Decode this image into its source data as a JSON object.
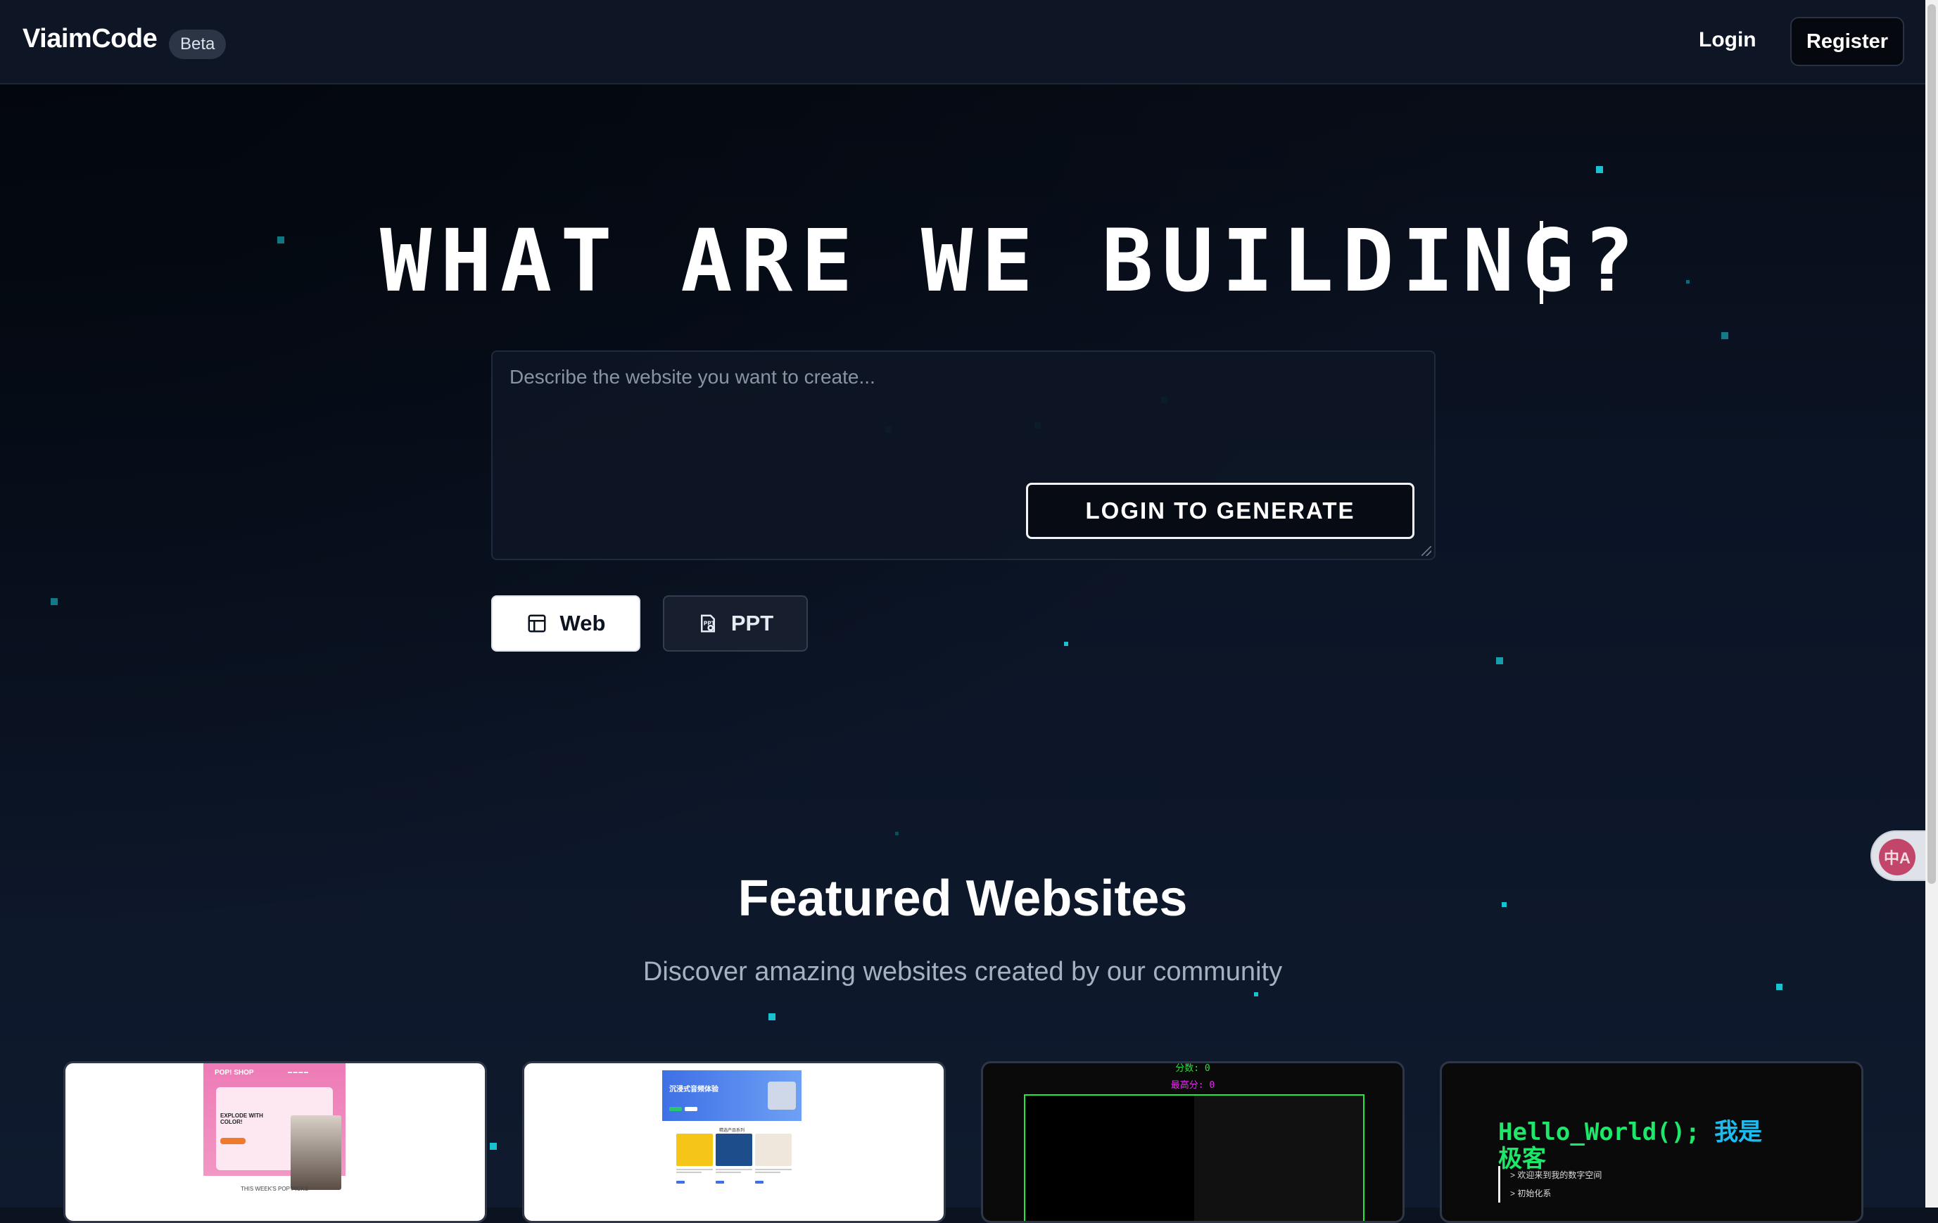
{
  "navbar": {
    "brand": "ViaimCode",
    "badge": "Beta",
    "login_label": "Login",
    "register_label": "Register"
  },
  "hero": {
    "title": "WHAT ARE WE BUILDING?",
    "prompt_placeholder": "Describe the website you want to create...",
    "generate_label": "LOGIN TO GENERATE",
    "modes": [
      {
        "label": "Web",
        "icon": "layout-icon",
        "selected": true
      },
      {
        "label": "PPT",
        "icon": "presentation-file-icon",
        "selected": false
      }
    ]
  },
  "featured": {
    "title": "Featured Websites",
    "subtitle": "Discover amazing websites created by our community",
    "cards": [
      {
        "shop_logo": "POP! SHOP",
        "hero_text": "EXPLODE WITH COLOR!",
        "caption": "THIS WEEK'S POP PICKS"
      },
      {
        "banner_title": "沉浸式音频体验",
        "section_title": "精选产品系列"
      },
      {
        "score": "分数: 0",
        "high_score": "最高分: 0"
      },
      {
        "hello": "Hello_World();",
        "hello_cn": "我是",
        "hello_cn2": "极客",
        "line1": "> 欢迎来到我的数字空间",
        "line2": "> 初始化系"
      }
    ]
  },
  "translate_button": {
    "icon": "translate-icon",
    "glyph": "中A"
  },
  "colors": {
    "accent": "#18c2cf",
    "background": "#0b1220",
    "terminal_green": "#1ee86a"
  }
}
